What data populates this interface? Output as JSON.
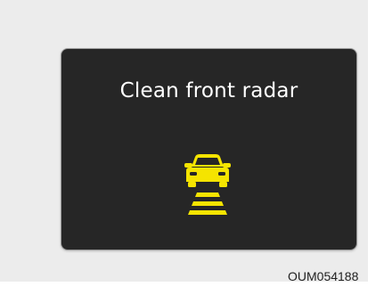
{
  "display": {
    "message": "Clean front radar",
    "icon": "front-radar-warning-icon",
    "icon_color": "#f5e400",
    "screen_color": "#262626"
  },
  "figure_code": "OUM054188"
}
